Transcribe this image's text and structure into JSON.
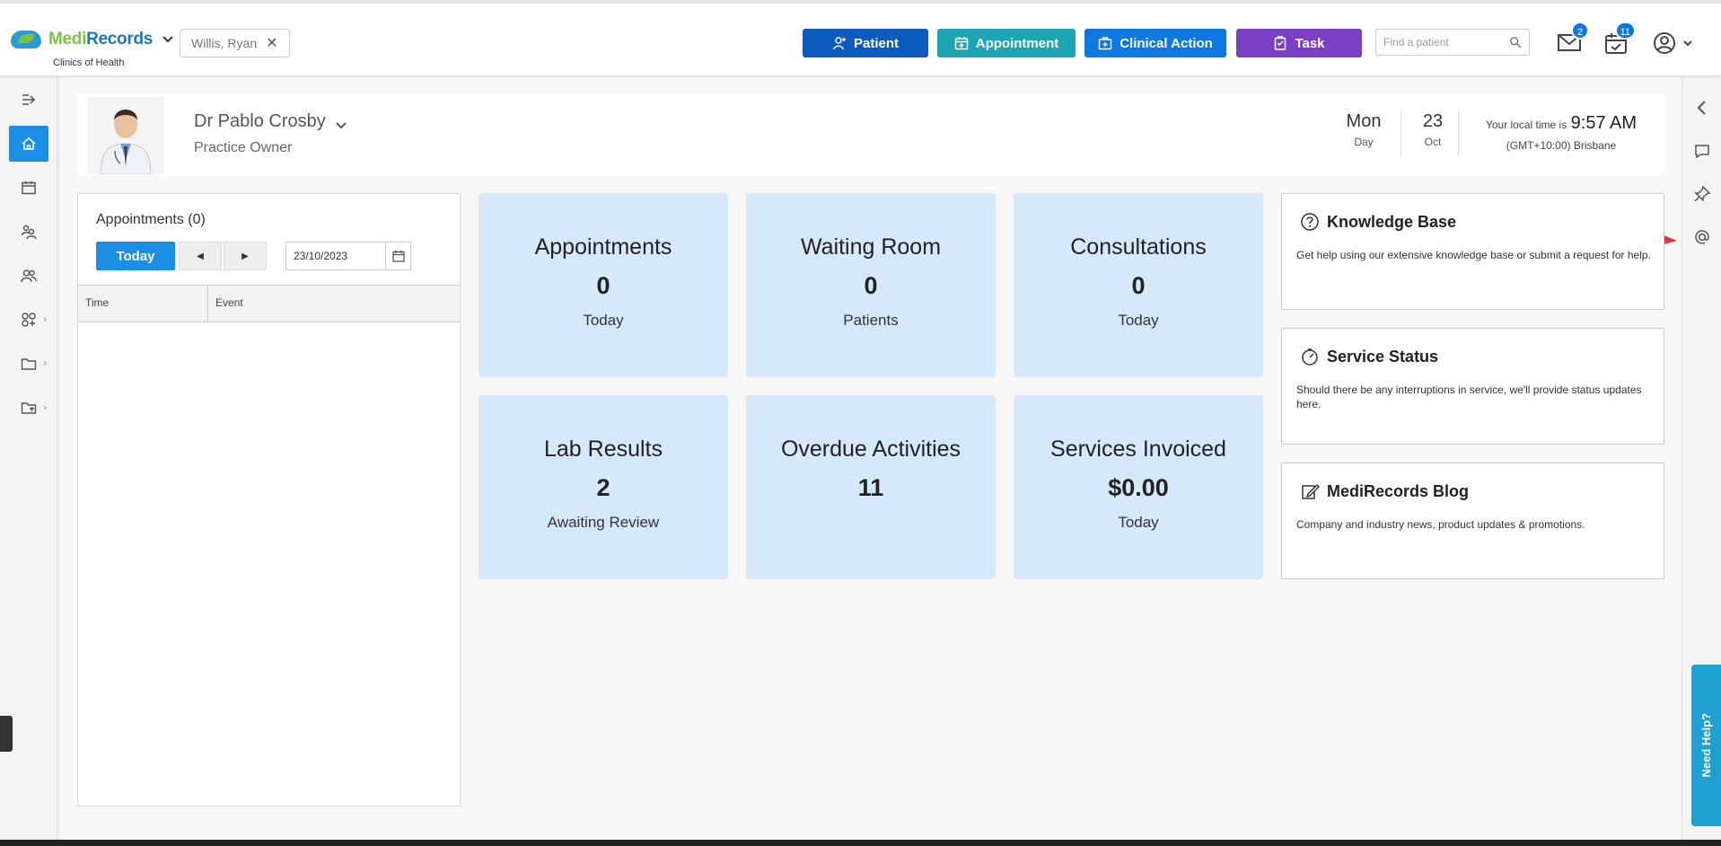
{
  "brand": {
    "logo_part1": "Medi",
    "logo_part2": "Records",
    "clinic": "Clinics of Health"
  },
  "patient_chip": {
    "name": "Willis, Ryan"
  },
  "toolbar": {
    "patient_label": "Patient",
    "appointment_label": "Appointment",
    "clinical_action_label": "Clinical Action",
    "task_label": "Task"
  },
  "search": {
    "placeholder": "Find a patient"
  },
  "badges": {
    "messages": "2",
    "tasks": "11"
  },
  "profile": {
    "name": "Dr Pablo Crosby",
    "role": "Practice Owner",
    "weekday": "Mon",
    "weekday_label": "Day",
    "day": "23",
    "month": "Oct",
    "local_time_label": "Your local time is",
    "local_time": "9:57 AM",
    "timezone": "(GMT+10:00) Brisbane"
  },
  "appointments": {
    "title": "Appointments (0)",
    "today_label": "Today",
    "date_value": "23/10/2023",
    "col_time": "Time",
    "col_event": "Event"
  },
  "tiles": [
    {
      "title": "Appointments",
      "value": "0",
      "sub": "Today"
    },
    {
      "title": "Waiting Room",
      "value": "0",
      "sub": "Patients"
    },
    {
      "title": "Consultations",
      "value": "0",
      "sub": "Today"
    },
    {
      "title": "Lab Results",
      "value": "2",
      "sub": "Awaiting Review"
    },
    {
      "title": "Overdue Activities",
      "value": "11",
      "sub": ""
    },
    {
      "title": "Services Invoiced",
      "value": "$0.00",
      "sub": "Today"
    }
  ],
  "cards": [
    {
      "title": "Knowledge Base",
      "body": "Get help using our extensive knowledge base or submit a request for help."
    },
    {
      "title": "Service Status",
      "body": "Should there be any interruptions in service, we'll provide status updates here."
    },
    {
      "title": "MediRecords Blog",
      "body": "Company and industry news, product updates & promotions."
    }
  ],
  "help": {
    "label": "Need Help?"
  },
  "colors": {
    "patient": "#0a5bbd",
    "appointment": "#1ea5b3",
    "clinical_action": "#0d79e0",
    "task": "#7a3fc4",
    "tile_bg": "#d6e8fb",
    "active_nav": "#1a8fe3",
    "arrow": "#e0343a"
  }
}
